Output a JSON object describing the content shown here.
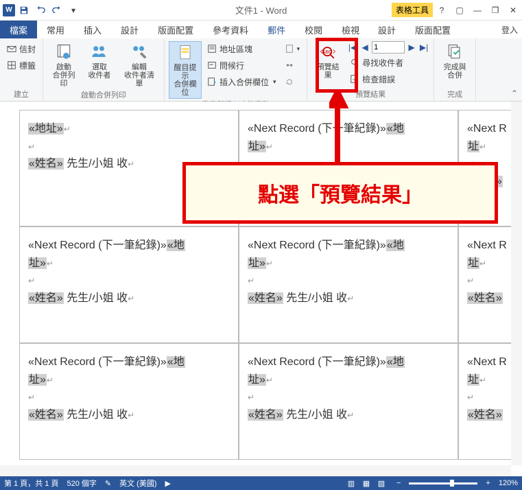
{
  "title": "文件1 - Word",
  "context_title": "表格工具",
  "login_label": "登入",
  "tabs": {
    "file": "檔案",
    "home": "常用",
    "insert": "插入",
    "design": "設計",
    "layout": "版面配置",
    "references": "參考資料",
    "mailings": "郵件",
    "review": "校閱",
    "view": "檢視",
    "ctx_design": "設計",
    "ctx_layout": "版面配置"
  },
  "ribbon": {
    "group_create": "建立",
    "envelopes": "信封",
    "labels": "標籤",
    "group_start": "啟動合併列印",
    "start_merge": "啟動\n合併列印",
    "select_recipients": "選取\n收件者",
    "edit_recipients": "編輯\n收件者清單",
    "group_write": "書寫與插入功能變數",
    "highlight_fields": "醒目提示\n合併欄位",
    "address_block": "地址區塊",
    "greeting_line": "問候行",
    "insert_merge_field": "插入合併欄位",
    "rules": "",
    "match_fields": "",
    "update_labels": "",
    "group_preview": "預覽結果",
    "preview_results": "預覽結果",
    "find_recipient": "尋找收件者",
    "check_errors": "檢查錯誤",
    "record_value": "1",
    "group_finish": "完成",
    "finish_merge": "完成與\n合併"
  },
  "doc": {
    "next_record": "«Next Record (下一筆紀錄)»",
    "next_record_cut": "«Next R",
    "address_field": "«地址»",
    "address_field_split1": "«地",
    "address_field_split2": "址»",
    "address_cut": "址",
    "name_field": "«姓名»",
    "suffix": " 先生/小姐  收"
  },
  "callout": "點選「預覽結果」",
  "status": {
    "page": "第 1 頁，共 1 頁",
    "words": "520 個字",
    "lang": "英文 (美國)",
    "zoom": "120%"
  }
}
